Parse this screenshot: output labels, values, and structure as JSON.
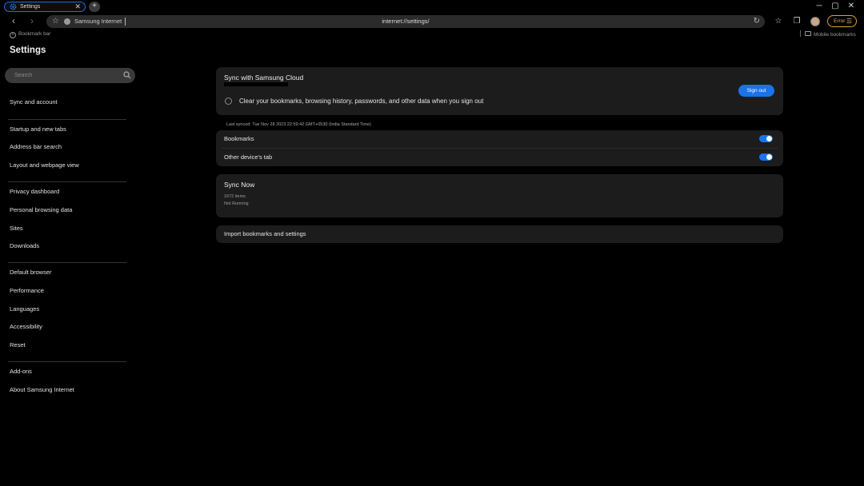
{
  "tab": {
    "title": "Settings",
    "close": "✕",
    "new": "+"
  },
  "window": {
    "minimize": "─",
    "maximize": "▢",
    "close": "✕"
  },
  "toolbar": {
    "back": "‹",
    "forward": "›",
    "site_name": "Samsung Internet",
    "url": "internet://settings/",
    "error_label": "Error"
  },
  "bookmark_bar": {
    "left_label": "Bookmark bar",
    "right_label": "Mobile bookmarks"
  },
  "sidebar": {
    "title": "Settings",
    "search_placeholder": "Search",
    "items": [
      "Sync and account",
      "Startup and new tabs",
      "Address bar search",
      "Layout and webpage view",
      "Privacy dashboard",
      "Personal browsing data",
      "Sites",
      "Downloads",
      "Default browser",
      "Performance",
      "Languages",
      "Accessibility",
      "Reset",
      "Add-ons",
      "About Samsung Internet"
    ]
  },
  "sync": {
    "title": "Sync with Samsung Cloud",
    "clear_option": "Clear your bookmarks, browsing history, passwords, and other data when you sign out",
    "sign_out": "Sign out",
    "last_synced": "Last synced: Tue Nov 28 2023 22:59:42 GMT+0530 (India Standard Time)",
    "toggles": [
      {
        "label": "Bookmarks",
        "on": true
      },
      {
        "label": "Other device's tab",
        "on": true
      }
    ],
    "sync_now": {
      "title": "Sync Now",
      "items": "1672 items",
      "status": "Not Running"
    },
    "import": "Import bookmarks and settings"
  },
  "colors": {
    "accent": "#1a73e8",
    "error": "#e0a030",
    "card": "#1c1c1c"
  }
}
